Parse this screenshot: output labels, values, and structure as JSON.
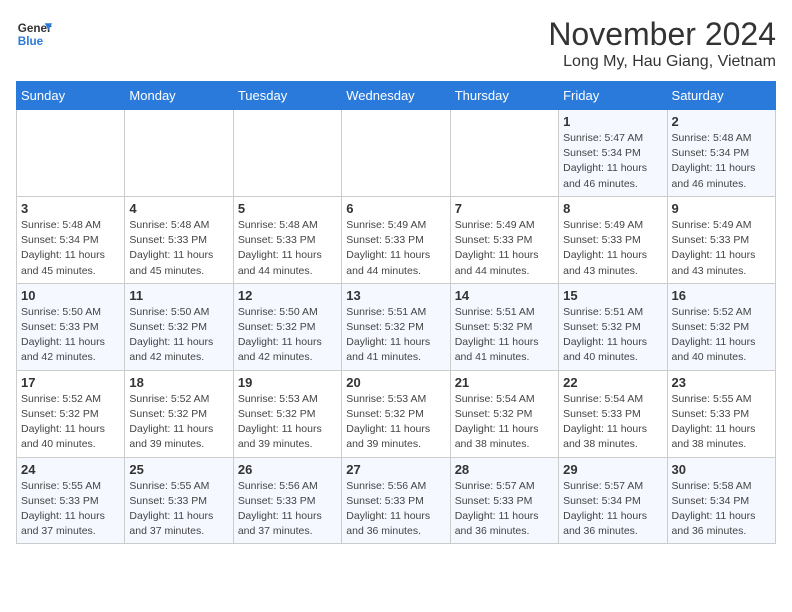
{
  "header": {
    "logo_line1": "General",
    "logo_line2": "Blue",
    "title": "November 2024",
    "subtitle": "Long My, Hau Giang, Vietnam"
  },
  "weekdays": [
    "Sunday",
    "Monday",
    "Tuesday",
    "Wednesday",
    "Thursday",
    "Friday",
    "Saturday"
  ],
  "weeks": [
    [
      {
        "day": "",
        "info": ""
      },
      {
        "day": "",
        "info": ""
      },
      {
        "day": "",
        "info": ""
      },
      {
        "day": "",
        "info": ""
      },
      {
        "day": "",
        "info": ""
      },
      {
        "day": "1",
        "info": "Sunrise: 5:47 AM\nSunset: 5:34 PM\nDaylight: 11 hours\nand 46 minutes."
      },
      {
        "day": "2",
        "info": "Sunrise: 5:48 AM\nSunset: 5:34 PM\nDaylight: 11 hours\nand 46 minutes."
      }
    ],
    [
      {
        "day": "3",
        "info": "Sunrise: 5:48 AM\nSunset: 5:34 PM\nDaylight: 11 hours\nand 45 minutes."
      },
      {
        "day": "4",
        "info": "Sunrise: 5:48 AM\nSunset: 5:33 PM\nDaylight: 11 hours\nand 45 minutes."
      },
      {
        "day": "5",
        "info": "Sunrise: 5:48 AM\nSunset: 5:33 PM\nDaylight: 11 hours\nand 44 minutes."
      },
      {
        "day": "6",
        "info": "Sunrise: 5:49 AM\nSunset: 5:33 PM\nDaylight: 11 hours\nand 44 minutes."
      },
      {
        "day": "7",
        "info": "Sunrise: 5:49 AM\nSunset: 5:33 PM\nDaylight: 11 hours\nand 44 minutes."
      },
      {
        "day": "8",
        "info": "Sunrise: 5:49 AM\nSunset: 5:33 PM\nDaylight: 11 hours\nand 43 minutes."
      },
      {
        "day": "9",
        "info": "Sunrise: 5:49 AM\nSunset: 5:33 PM\nDaylight: 11 hours\nand 43 minutes."
      }
    ],
    [
      {
        "day": "10",
        "info": "Sunrise: 5:50 AM\nSunset: 5:33 PM\nDaylight: 11 hours\nand 42 minutes."
      },
      {
        "day": "11",
        "info": "Sunrise: 5:50 AM\nSunset: 5:32 PM\nDaylight: 11 hours\nand 42 minutes."
      },
      {
        "day": "12",
        "info": "Sunrise: 5:50 AM\nSunset: 5:32 PM\nDaylight: 11 hours\nand 42 minutes."
      },
      {
        "day": "13",
        "info": "Sunrise: 5:51 AM\nSunset: 5:32 PM\nDaylight: 11 hours\nand 41 minutes."
      },
      {
        "day": "14",
        "info": "Sunrise: 5:51 AM\nSunset: 5:32 PM\nDaylight: 11 hours\nand 41 minutes."
      },
      {
        "day": "15",
        "info": "Sunrise: 5:51 AM\nSunset: 5:32 PM\nDaylight: 11 hours\nand 40 minutes."
      },
      {
        "day": "16",
        "info": "Sunrise: 5:52 AM\nSunset: 5:32 PM\nDaylight: 11 hours\nand 40 minutes."
      }
    ],
    [
      {
        "day": "17",
        "info": "Sunrise: 5:52 AM\nSunset: 5:32 PM\nDaylight: 11 hours\nand 40 minutes."
      },
      {
        "day": "18",
        "info": "Sunrise: 5:52 AM\nSunset: 5:32 PM\nDaylight: 11 hours\nand 39 minutes."
      },
      {
        "day": "19",
        "info": "Sunrise: 5:53 AM\nSunset: 5:32 PM\nDaylight: 11 hours\nand 39 minutes."
      },
      {
        "day": "20",
        "info": "Sunrise: 5:53 AM\nSunset: 5:32 PM\nDaylight: 11 hours\nand 39 minutes."
      },
      {
        "day": "21",
        "info": "Sunrise: 5:54 AM\nSunset: 5:32 PM\nDaylight: 11 hours\nand 38 minutes."
      },
      {
        "day": "22",
        "info": "Sunrise: 5:54 AM\nSunset: 5:33 PM\nDaylight: 11 hours\nand 38 minutes."
      },
      {
        "day": "23",
        "info": "Sunrise: 5:55 AM\nSunset: 5:33 PM\nDaylight: 11 hours\nand 38 minutes."
      }
    ],
    [
      {
        "day": "24",
        "info": "Sunrise: 5:55 AM\nSunset: 5:33 PM\nDaylight: 11 hours\nand 37 minutes."
      },
      {
        "day": "25",
        "info": "Sunrise: 5:55 AM\nSunset: 5:33 PM\nDaylight: 11 hours\nand 37 minutes."
      },
      {
        "day": "26",
        "info": "Sunrise: 5:56 AM\nSunset: 5:33 PM\nDaylight: 11 hours\nand 37 minutes."
      },
      {
        "day": "27",
        "info": "Sunrise: 5:56 AM\nSunset: 5:33 PM\nDaylight: 11 hours\nand 36 minutes."
      },
      {
        "day": "28",
        "info": "Sunrise: 5:57 AM\nSunset: 5:33 PM\nDaylight: 11 hours\nand 36 minutes."
      },
      {
        "day": "29",
        "info": "Sunrise: 5:57 AM\nSunset: 5:34 PM\nDaylight: 11 hours\nand 36 minutes."
      },
      {
        "day": "30",
        "info": "Sunrise: 5:58 AM\nSunset: 5:34 PM\nDaylight: 11 hours\nand 36 minutes."
      }
    ]
  ]
}
